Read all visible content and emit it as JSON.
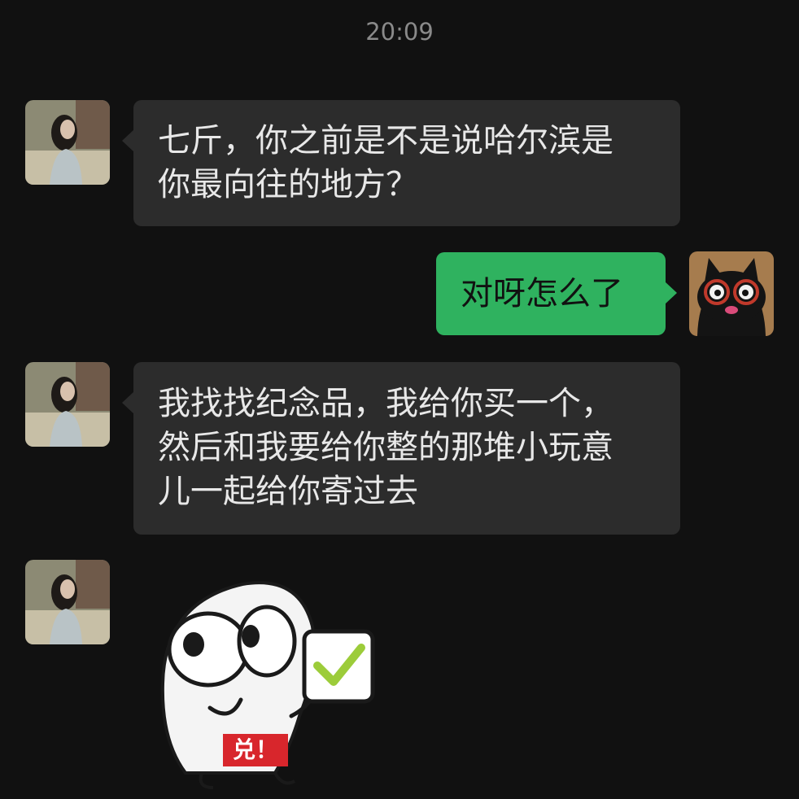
{
  "timestamp": "20:09",
  "messages": [
    {
      "sender": "other",
      "lines": [
        "七斤，你之前是不是说哈尔滨是",
        "你最向往的地方？"
      ]
    },
    {
      "sender": "self",
      "lines": [
        "对呀怎么了"
      ]
    },
    {
      "sender": "other",
      "lines": [
        "我找找纪念品，我给你买一个，",
        "然后和我要给你整的那堆小玩意",
        "儿一起给你寄过去"
      ]
    },
    {
      "sender": "other",
      "type": "sticker",
      "sticker_text": "兑！",
      "sticker_icon": "thumbs-up-checkmark-face-sticker"
    }
  ],
  "colors": {
    "background": "#111111",
    "incoming_bubble": "#2c2c2c",
    "outgoing_bubble": "#2fb25f",
    "timestamp": "#8a8a8a",
    "sticker_label": "#d8262c"
  }
}
